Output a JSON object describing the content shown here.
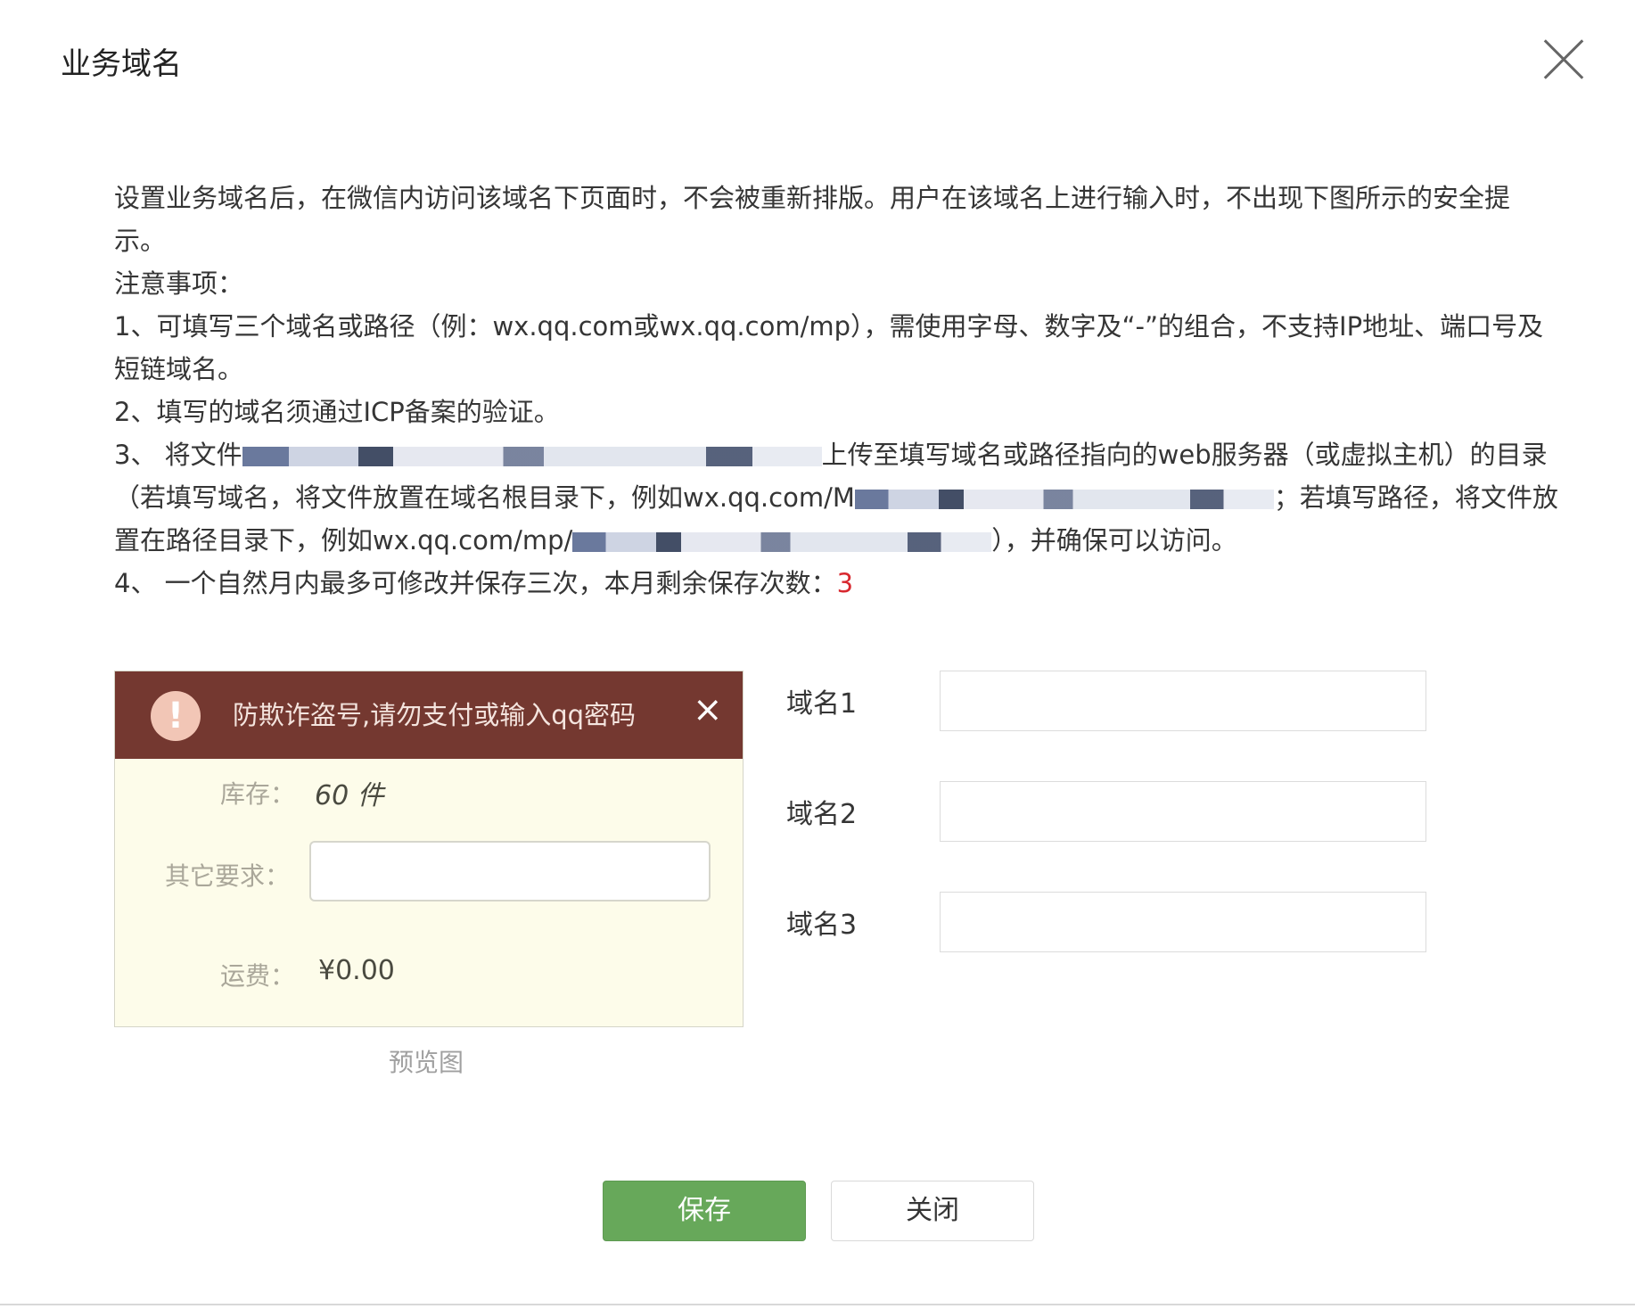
{
  "dialog": {
    "title": "业务域名"
  },
  "notes": {
    "intro": "设置业务域名后，在微信内访问该域名下页面时，不会被重新排版。用户在该域名上进行输入时，不出现下图所示的安全提示。",
    "heading": "注意事项：",
    "item1": "1、可填写三个域名或路径（例：wx.qq.com或wx.qq.com/mp），需使用字母、数字及“-”的组合，不支持IP地址、端口号及短链域名。",
    "item2": "2、填写的域名须通过ICP备案的验证。",
    "item3_a": "3、 将文件",
    "item3_b": "上传至填写域名或路径指向的web服务器（或虚拟主机）的目录（若填写域名，将文件放置在域名根目录下，例如wx.qq.com/M",
    "item3_c": "；若填写路径，将文件放置在路径目录下，例如wx.qq.com/mp/",
    "item3_d": "），并确保可以访问。",
    "item4_prefix": "4、 一个自然月内最多可修改并保存三次，本月剩余保存次数：",
    "item4_remaining": "3"
  },
  "preview": {
    "warning_text": "防欺诈盗号,请勿支付或输入qq密码",
    "close_glyph": "×",
    "alert_glyph": "!",
    "stock_label": "库存：",
    "stock_value": "60 件",
    "other_label": "其它要求：",
    "shipping_label": "运费：",
    "shipping_value": "¥0.00",
    "caption": "预览图"
  },
  "fields": [
    {
      "label": "域名1",
      "value": ""
    },
    {
      "label": "域名2",
      "value": ""
    },
    {
      "label": "域名3",
      "value": ""
    }
  ],
  "buttons": {
    "save": "保存",
    "close": "关闭"
  }
}
